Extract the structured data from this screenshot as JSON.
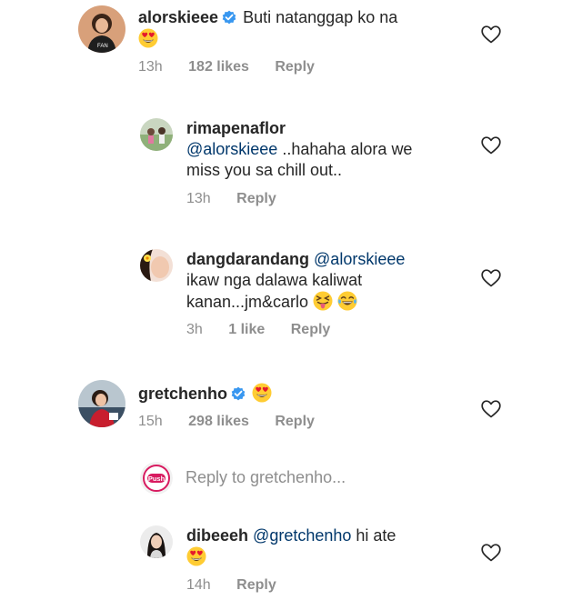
{
  "comments": [
    {
      "username": "alorskieee",
      "verified": true,
      "text": "Buti natanggap ko na",
      "emoji": [
        "heart-eyes"
      ],
      "time": "13h",
      "likes": "182 likes",
      "reply": "Reply"
    },
    {
      "username": "rimapenaflor",
      "mention": "@alorskieee",
      "text1": "..hahaha alora we",
      "text2": "miss you sa chill out..",
      "time": "13h",
      "reply": "Reply"
    },
    {
      "username": "dangdarandang",
      "mention": "@alorskieee",
      "text1": "ikaw nga dalawa kaliwat",
      "text2": "kanan...jm&carlo",
      "emoji": [
        "tongue-out",
        "tears-of-joy"
      ],
      "time": "3h",
      "likes": "1 like",
      "reply": "Reply"
    },
    {
      "username": "gretchenho",
      "verified": true,
      "emoji": [
        "heart-eyes"
      ],
      "time": "15h",
      "likes": "298 likes",
      "reply": "Reply"
    },
    {
      "username": "dibeeeh",
      "mention": "@gretchenho",
      "text": "hi ate",
      "emoji": [
        "heart-eyes"
      ],
      "time": "14h",
      "reply": "Reply"
    }
  ],
  "reply_input": {
    "placeholder": "Reply to gretchenho...",
    "avatar_text": "Push"
  },
  "colors": {
    "text": "#262626",
    "muted": "#8e8e8e",
    "mention": "#00376b",
    "verified": "#3897f0",
    "push_brand": "#d81b60"
  }
}
